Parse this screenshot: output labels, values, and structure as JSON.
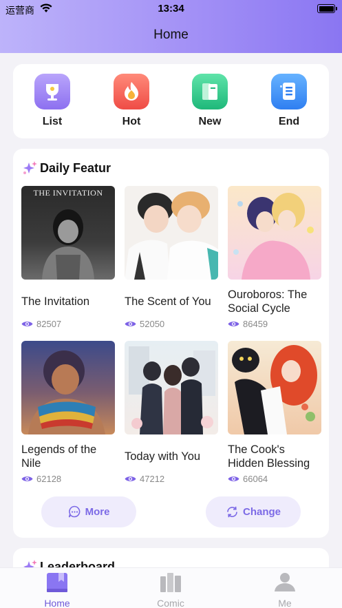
{
  "status": {
    "carrier": "运营商",
    "time": "13:34"
  },
  "header": {
    "title": "Home"
  },
  "categories": [
    {
      "label": "List",
      "icon": "trophy-icon"
    },
    {
      "label": "Hot",
      "icon": "flame-icon"
    },
    {
      "label": "New",
      "icon": "new-book-icon"
    },
    {
      "label": "End",
      "icon": "document-list-icon"
    }
  ],
  "daily": {
    "title": "Daily Featur",
    "books": [
      {
        "title": "The Invitation",
        "views": "82507",
        "cover_text": "THE INVITATION"
      },
      {
        "title": "The Scent of You",
        "views": "52050"
      },
      {
        "title": "Ouroboros: The Social Cycle",
        "views": "86459"
      },
      {
        "title": "Legends of the Nile",
        "views": "62128"
      },
      {
        "title": "Today with You",
        "views": "47212"
      },
      {
        "title": "The Cook's Hidden Blessing",
        "views": "66064"
      }
    ],
    "more_label": "More",
    "change_label": "Change"
  },
  "leaderboard": {
    "title": "Leaderboard"
  },
  "tabs": [
    {
      "label": "Home",
      "active": true
    },
    {
      "label": "Comic",
      "active": false
    },
    {
      "label": "Me",
      "active": false
    }
  ],
  "colors": {
    "accent": "#8a76f2",
    "header_start": "#bdb3fa",
    "pill_bg": "#efecfc"
  }
}
